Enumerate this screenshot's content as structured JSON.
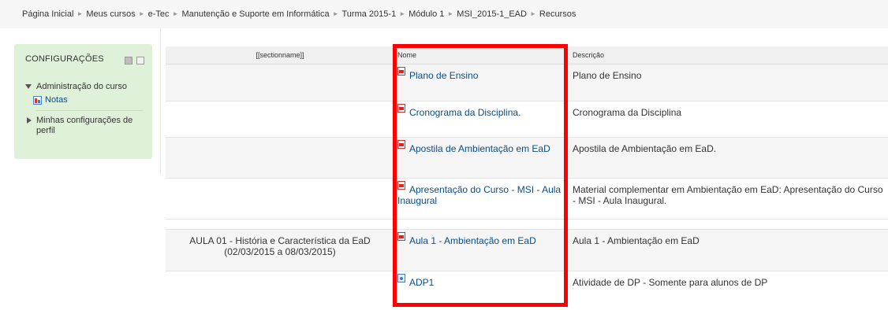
{
  "breadcrumb": [
    "Página Inicial",
    "Meus cursos",
    "e-Tec",
    "Manutenção e Suporte em Informática",
    "Turma 2015-1",
    "Módulo 1",
    "MSI_2015-1_EAD",
    "Recursos"
  ],
  "breadcrumb_separator": "►",
  "settings_block": {
    "title": "CONFIGURAÇÕES",
    "items": [
      {
        "label": "Administração do curso",
        "expanded": true,
        "children": [
          {
            "label": "Notas",
            "icon": "grades-icon"
          }
        ]
      },
      {
        "label": "Minhas configurações de perfil",
        "expanded": false
      }
    ]
  },
  "table": {
    "headers": [
      "[[sectionname]]",
      "Nome",
      "Descrição"
    ],
    "rows": [
      {
        "section": "",
        "name": "Plano de Ensino",
        "icon": "pdf-icon",
        "description": "Plano de Ensino"
      },
      {
        "section": "",
        "name": "Cronograma da Disciplina.",
        "icon": "pdf-icon",
        "description": "Cronograma da Disciplina"
      },
      {
        "section": "",
        "name": "Apostila de Ambientação em EaD",
        "icon": "pdf-icon",
        "description": "Apostila de Ambientação em EaD."
      },
      {
        "section": "",
        "name": "Apresentação do Curso - MSI - Aula Inaugural",
        "icon": "pdf-icon",
        "description": "Material complementar em Ambientação em EaD: Apresentação do Curso - MSI - Aula Inaugural."
      },
      {
        "section": "AULA 01 - História e Característica da EaD (02/03/2015 a 08/03/2015)",
        "name": "Aula 1 - Ambientação em EaD",
        "icon": "pdf-icon",
        "description": "Aula 1 - Ambientação em EaD"
      },
      {
        "section": "",
        "name": "ADP1",
        "icon": "url-icon",
        "description": "Atividade de DP - Somente para alunos de DP"
      }
    ]
  },
  "colors": {
    "highlight": "#ff0000",
    "block_bg": "#dff1d8",
    "link": "#0a4c86"
  }
}
